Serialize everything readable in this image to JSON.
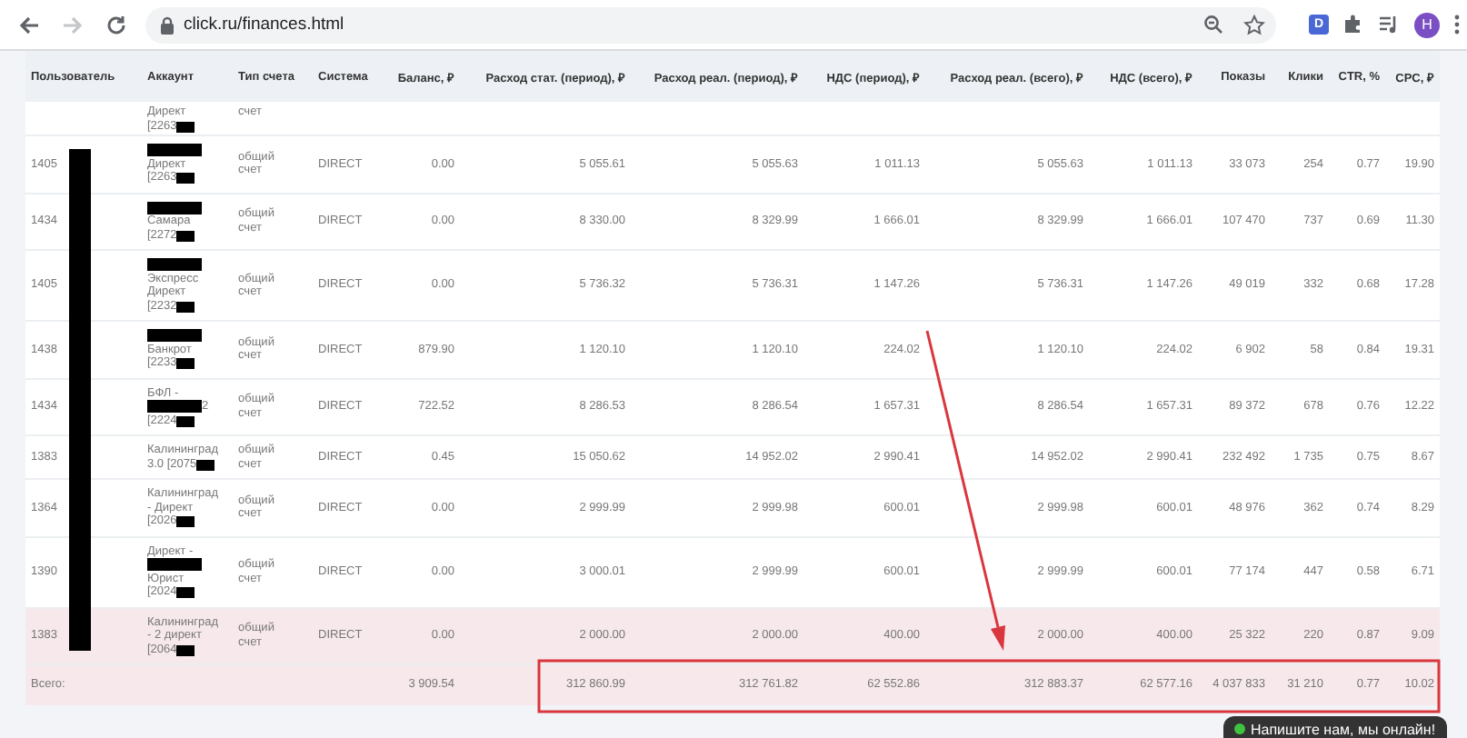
{
  "browser": {
    "url": "click.ru/finances.html",
    "extension_label": "D",
    "avatar": "H"
  },
  "table": {
    "columns": [
      "Пользователь",
      "Аккаунт",
      "Тип счета",
      "Система",
      "Баланс, ₽",
      "Расход стат. (период), ₽",
      "Расход реал. (период), ₽",
      "НДС (период), ₽",
      "Расход реал. (всего), ₽",
      "НДС (всего), ₽",
      "Показы",
      "Клики",
      "CTR, %",
      "CPC, ₽"
    ],
    "rows": [
      {
        "kind": "partial",
        "user": "",
        "account": [
          [
            {
              "kind": "text",
              "text": "Директ"
            }
          ],
          [
            {
              "kind": "text",
              "text": "[2263"
            },
            {
              "kind": "mark"
            }
          ]
        ],
        "type": "счет",
        "system": "",
        "values": [],
        "highlighted": false
      },
      {
        "kind": "full",
        "user": "1405",
        "account": [
          [
            {
              "kind": "bar"
            }
          ],
          [
            {
              "kind": "text",
              "text": "Директ"
            }
          ],
          [
            {
              "kind": "text",
              "text": "[2263"
            },
            {
              "kind": "mark"
            }
          ]
        ],
        "type": "общий счет",
        "system": "DIRECT",
        "values": [
          "0.00",
          "5 055.61",
          "5 055.63",
          "1 011.13",
          "5 055.63",
          "1 011.13",
          "33 073",
          "254",
          "0.77",
          "19.90"
        ],
        "highlighted": false
      },
      {
        "kind": "full",
        "user": "1434",
        "account": [
          [
            {
              "kind": "bar"
            }
          ],
          [
            {
              "kind": "text",
              "text": "Самара"
            }
          ],
          [
            {
              "kind": "text",
              "text": "[2272"
            },
            {
              "kind": "mark"
            }
          ]
        ],
        "type": "общий счет",
        "system": "DIRECT",
        "values": [
          "0.00",
          "8 330.00",
          "8 329.99",
          "1 666.01",
          "8 329.99",
          "1 666.01",
          "107 470",
          "737",
          "0.69",
          "11.30"
        ],
        "highlighted": false
      },
      {
        "kind": "full",
        "user": "1405",
        "account": [
          [
            {
              "kind": "bar"
            }
          ],
          [
            {
              "kind": "text",
              "text": "Экспресс"
            }
          ],
          [
            {
              "kind": "text",
              "text": "Директ"
            }
          ],
          [
            {
              "kind": "text",
              "text": "[2232"
            },
            {
              "kind": "mark"
            }
          ]
        ],
        "type": "общий счет",
        "system": "DIRECT",
        "values": [
          "0.00",
          "5 736.32",
          "5 736.31",
          "1 147.26",
          "5 736.31",
          "1 147.26",
          "49 019",
          "332",
          "0.68",
          "17.28"
        ],
        "highlighted": false
      },
      {
        "kind": "full",
        "user": "1438",
        "account": [
          [
            {
              "kind": "bar"
            }
          ],
          [
            {
              "kind": "text",
              "text": "Банкрот"
            }
          ],
          [
            {
              "kind": "text",
              "text": "[2233"
            },
            {
              "kind": "mark"
            }
          ]
        ],
        "type": "общий счет",
        "system": "DIRECT",
        "values": [
          "879.90",
          "1 120.10",
          "1 120.10",
          "224.02",
          "1 120.10",
          "224.02",
          "6 902",
          "58",
          "0.84",
          "19.31"
        ],
        "highlighted": false
      },
      {
        "kind": "full",
        "user": "1434",
        "account": [
          [
            {
              "kind": "text",
              "text": "БФЛ -"
            }
          ],
          [
            {
              "kind": "bar"
            },
            {
              "kind": "text",
              "text": "2"
            }
          ],
          [
            {
              "kind": "text",
              "text": "[2224"
            },
            {
              "kind": "mark"
            }
          ]
        ],
        "type": "общий счет",
        "system": "DIRECT",
        "values": [
          "722.52",
          "8 286.53",
          "8 286.54",
          "1 657.31",
          "8 286.54",
          "1 657.31",
          "89 372",
          "678",
          "0.76",
          "12.22"
        ],
        "highlighted": false
      },
      {
        "kind": "full",
        "user": "1383",
        "account": [
          [
            {
              "kind": "text",
              "text": "Калининград"
            }
          ],
          [
            {
              "kind": "text",
              "text": "3.0 [2075"
            },
            {
              "kind": "mark"
            }
          ]
        ],
        "type": "общий счет",
        "system": "DIRECT",
        "values": [
          "0.45",
          "15 050.62",
          "14 952.02",
          "2 990.41",
          "14 952.02",
          "2 990.41",
          "232 492",
          "1 735",
          "0.75",
          "8.67"
        ],
        "highlighted": false
      },
      {
        "kind": "full",
        "user": "1364",
        "account": [
          [
            {
              "kind": "text",
              "text": "Калининград"
            }
          ],
          [
            {
              "kind": "text",
              "text": "- Директ"
            }
          ],
          [
            {
              "kind": "text",
              "text": "[2026"
            },
            {
              "kind": "mark"
            }
          ]
        ],
        "type": "общий счет",
        "system": "DIRECT",
        "values": [
          "0.00",
          "2 999.99",
          "2 999.98",
          "600.01",
          "2 999.98",
          "600.01",
          "48 976",
          "362",
          "0.74",
          "8.29"
        ],
        "highlighted": false
      },
      {
        "kind": "full",
        "user": "1390",
        "account": [
          [
            {
              "kind": "text",
              "text": "Директ -"
            }
          ],
          [
            {
              "kind": "bar"
            }
          ],
          [
            {
              "kind": "text",
              "text": "Юрист"
            }
          ],
          [
            {
              "kind": "text",
              "text": "[2024"
            },
            {
              "kind": "mark"
            }
          ]
        ],
        "type": "общий счет",
        "system": "DIRECT",
        "values": [
          "0.00",
          "3 000.01",
          "2 999.99",
          "600.01",
          "2 999.99",
          "600.01",
          "77 174",
          "447",
          "0.58",
          "6.71"
        ],
        "highlighted": false
      },
      {
        "kind": "full",
        "user": "1383",
        "account": [
          [
            {
              "kind": "text",
              "text": "Калининград"
            }
          ],
          [
            {
              "kind": "text",
              "text": "- 2 директ"
            }
          ],
          [
            {
              "kind": "text",
              "text": "[2064"
            },
            {
              "kind": "mark"
            }
          ]
        ],
        "type": "общий счет",
        "system": "DIRECT",
        "values": [
          "0.00",
          "2 000.00",
          "2 000.00",
          "400.00",
          "2 000.00",
          "400.00",
          "25 322",
          "220",
          "0.87",
          "9.09"
        ],
        "highlighted": true
      }
    ],
    "totals": {
      "label": "Всего:",
      "values": [
        "3 909.54",
        "312 860.99",
        "312 761.82",
        "62 552.86",
        "312 883.37",
        "62 577.16",
        "4 037 833",
        "31 210",
        "0.77",
        "10.02"
      ],
      "highlighted": true
    }
  },
  "chat": {
    "text": "Напишите нам, мы онлайн!",
    "online": true
  }
}
